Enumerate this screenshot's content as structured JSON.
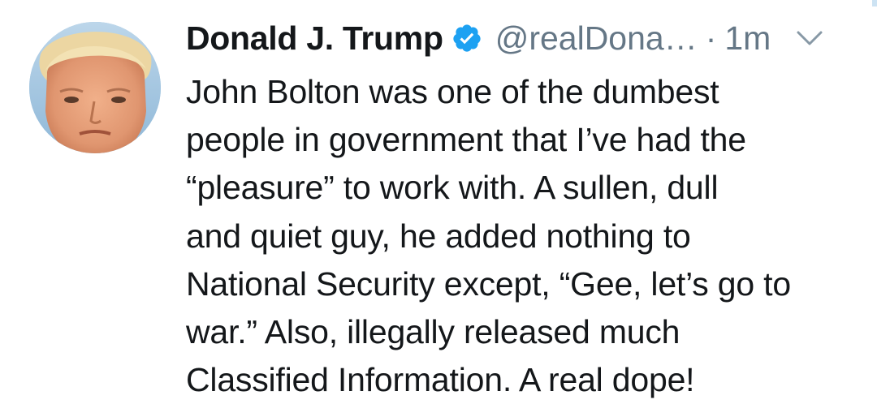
{
  "tweet": {
    "author": {
      "display_name": "Donald J. Trump",
      "handle": "@realDona…",
      "verified_icon": "verified-badge-icon",
      "avatar": "profile-photo"
    },
    "separator": "·",
    "timestamp": "1m",
    "menu_icon": "chevron-down-icon",
    "text": "John Bolton was one of the dumbest\npeople in government that I’ve had the\n“pleasure” to work with. A sullen, dull\nand quiet guy, he added nothing to\nNational Security except, “Gee, let’s go to\nwar.” Also, illegally released much\nClassified Information. A real dope!"
  },
  "colors": {
    "text": "#14171a",
    "secondary": "#657786",
    "verified": "#1da1f2"
  }
}
